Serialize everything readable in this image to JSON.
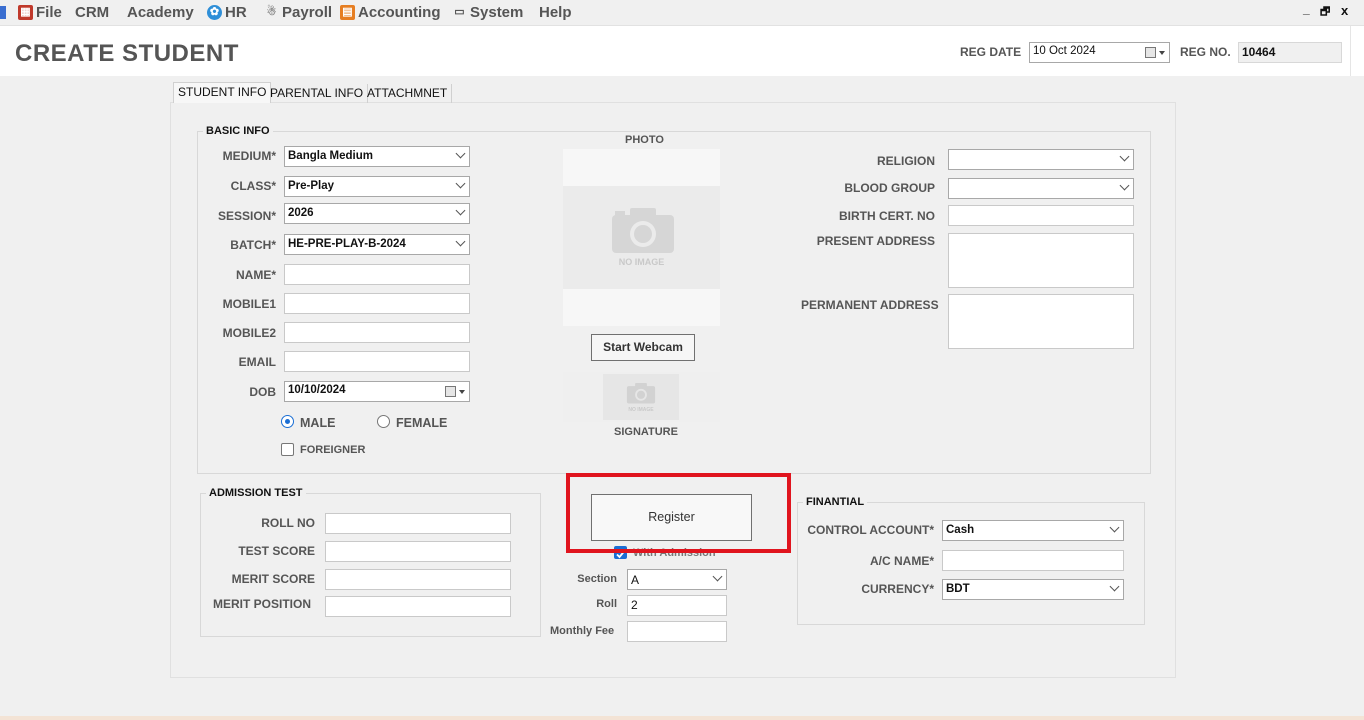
{
  "menu": [
    {
      "label": "File",
      "icon": "app-icon"
    },
    {
      "label": "CRM",
      "icon": ""
    },
    {
      "label": "Academy",
      "icon": ""
    },
    {
      "label": "HR",
      "icon": "hr-icon"
    },
    {
      "label": "Payroll",
      "icon": "payroll-icon"
    },
    {
      "label": "Accounting",
      "icon": "accounting-icon"
    },
    {
      "label": "System",
      "icon": "system-icon"
    },
    {
      "label": "Help",
      "icon": ""
    }
  ],
  "window_controls": {
    "minimize": "_",
    "restore": "🗗",
    "close": "x"
  },
  "header": {
    "title": "CREATE STUDENT",
    "reg_date_label": "REG DATE",
    "reg_date_value": "10 Oct  2024",
    "reg_no_label": "REG NO.",
    "reg_no_value": "10464"
  },
  "tabs": [
    "STUDENT INFO",
    "PARENTAL INFO",
    "ATTACHMNET"
  ],
  "basic_info": {
    "group_label": "BASIC INFO",
    "medium_label": "MEDIUM*",
    "medium_value": "Bangla Medium",
    "class_label": "CLASS*",
    "class_value": "Pre-Play",
    "session_label": "SESSION*",
    "session_value": "2026",
    "batch_label": "BATCH*",
    "batch_value": "HE-PRE-PLAY-B-2024",
    "name_label": "NAME*",
    "name_value": "",
    "mobile1_label": "MOBILE1",
    "mobile1_value": "",
    "mobile2_label": "MOBILE2",
    "mobile2_value": "",
    "email_label": "EMAIL",
    "email_value": "",
    "dob_label": "DOB",
    "dob_value": "10/10/2024",
    "male_label": "MALE",
    "female_label": "FEMALE",
    "gender_selected": "MALE",
    "foreigner_label": "FOREIGNER",
    "foreigner_checked": false
  },
  "photo": {
    "label": "PHOTO",
    "no_image_text": "NO IMAGE",
    "webcam_button": "Start Webcam",
    "signature_label": "SIGNATURE",
    "signature_no_image": "NO IMAGE"
  },
  "personal": {
    "religion_label": "RELIGION",
    "religion_value": "",
    "blood_group_label": "BLOOD GROUP",
    "blood_group_value": "",
    "birth_cert_label": "BIRTH CERT. NO",
    "birth_cert_value": "",
    "present_address_label": "PRESENT ADDRESS",
    "present_address_value": "",
    "permanent_address_label": "PERMANENT ADDRESS",
    "permanent_address_value": ""
  },
  "admission_test": {
    "group_label": "ADMISSION TEST",
    "roll_no_label": "ROLL NO",
    "roll_no_value": "",
    "test_score_label": "TEST SCORE",
    "test_score_value": "",
    "merit_score_label": "MERIT SCORE",
    "merit_score_value": "",
    "merit_position_label": "MERIT POSITION",
    "merit_position_value": ""
  },
  "register": {
    "button_label": "Register",
    "with_admission_label": "With Admission",
    "with_admission_checked": true,
    "section_label": "Section",
    "section_value": "A",
    "roll_label": "Roll",
    "roll_value": "2",
    "monthly_fee_label": "Monthly Fee",
    "monthly_fee_value": "",
    "highlight_color": "#e0141e"
  },
  "financial": {
    "group_label": "FINANTIAL",
    "control_account_label": "CONTROL ACCOUNT*",
    "control_account_value": "Cash",
    "ac_name_label": "A/C NAME*",
    "ac_name_value": "",
    "currency_label": "CURRENCY*",
    "currency_value": "BDT"
  }
}
